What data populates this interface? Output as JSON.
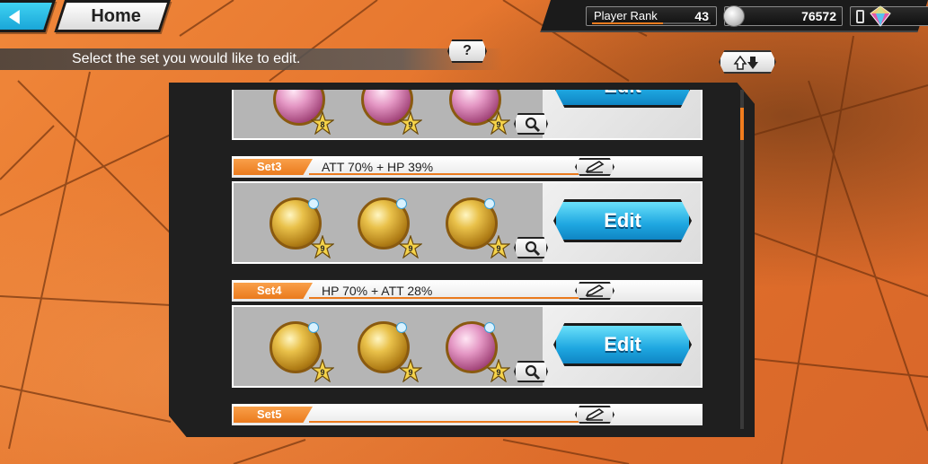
{
  "topbar": {
    "home_label": "Home",
    "player_rank_label": "Player Rank",
    "player_rank_value": "43",
    "player_rank_progress": 0.6,
    "coins": "76572"
  },
  "instruction": {
    "text": "Select the set you would like to edit.",
    "help_label": "?"
  },
  "sets": [
    {
      "name": "",
      "description": "",
      "edit_label": "Edit",
      "medals": [
        {
          "color": "pink",
          "level": "8"
        },
        {
          "color": "pink",
          "level": "9"
        },
        {
          "color": "pink",
          "level": "9"
        }
      ]
    },
    {
      "name": "Set3",
      "description": "ATT 70% + HP 39%",
      "edit_label": "Edit",
      "medals": [
        {
          "color": "gold",
          "level": "9"
        },
        {
          "color": "gold",
          "level": "9"
        },
        {
          "color": "gold",
          "level": "9"
        }
      ]
    },
    {
      "name": "Set4",
      "description": "HP 70% + ATT 28%",
      "edit_label": "Edit",
      "medals": [
        {
          "color": "gold",
          "level": "9"
        },
        {
          "color": "gold",
          "level": "9"
        },
        {
          "color": "pink",
          "level": "9"
        }
      ]
    },
    {
      "name": "Set5",
      "description": "",
      "edit_label": "Edit",
      "medals": []
    }
  ],
  "icons": {
    "back": "back-arrow-icon",
    "coin": "coin-icon",
    "gem": "gem-icon",
    "phone": "phone-icon",
    "sort": "sort-arrows-icon",
    "rename": "pen-icon",
    "magnify": "magnifier-icon"
  },
  "colors": {
    "accent_orange": "#ea7a1d",
    "button_blue": "#1ea6e0",
    "background_orange": "#e8772e"
  }
}
